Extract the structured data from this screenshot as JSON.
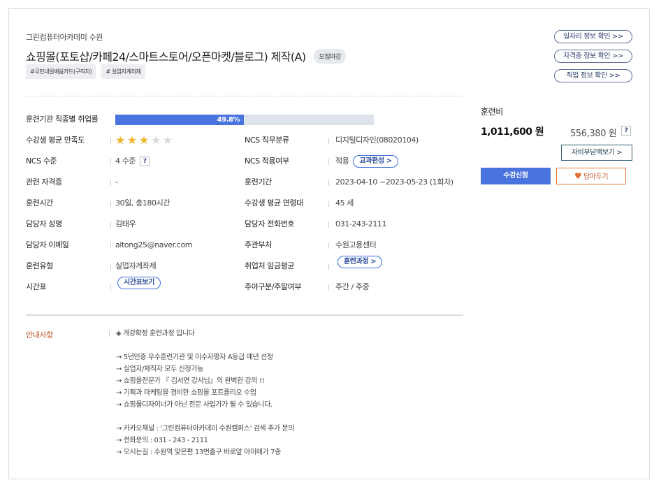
{
  "header": {
    "academy": "그린컴퓨터아카데미 수원",
    "title": "쇼핑몰(포토샵/카페24/스마트스토어/오픈마켓/블로그) 제작(A)",
    "status_badge": "모집마감",
    "tags": [
      "#국민내일배움카드(구직자)",
      "# 실업자계좌제"
    ]
  },
  "info_buttons": [
    "일자리 정보 확인 >>",
    "자격증 정보 확인 >>",
    "직업 정보 확인 >>"
  ],
  "details": {
    "employment_rate_label": "훈련기관 직종별 취업률",
    "employment_rate_text": "49.8%",
    "employment_rate_fraction": 0.498,
    "satisfaction_label": "수강생 평균 만족도",
    "satisfaction_stars": 3,
    "satisfaction_max": 5,
    "ncs_category_label": "NCS 직무분류",
    "ncs_category_value": "디지털디자인(08020104)",
    "ncs_level_label": "NCS 수준",
    "ncs_level_value": "4 수준",
    "ncs_apply_label": "NCS 적용여부",
    "ncs_apply_value": "적용",
    "curriculum_button": "교과편성 >",
    "cert_label": "관련 자격증",
    "cert_value": "-",
    "period_label": "훈련기간",
    "period_value": "2023-04-10 ~2023-05-23 (1회차)",
    "hours_label": "훈련시간",
    "hours_value": "30일, 총180시간",
    "age_label": "수강생 평균 연령대",
    "age_value": "45 세",
    "manager_label": "담당자 성명",
    "manager_value": "김태우",
    "phone_label": "담당자 전화번호",
    "phone_value": "031-243-2111",
    "email_label": "담당자 이메일",
    "email_value": "altong25@naver.com",
    "org_label": "주관부처",
    "org_value": "수원고용센터",
    "type_label": "훈련유형",
    "type_value": "실업자계좌제",
    "wage_label": "취업처 임금평균",
    "wage_button": "훈련과정 >",
    "timetable_label": "시간표",
    "timetable_button": "시간표보기",
    "daynight_label": "주야구분/주말여부",
    "daynight_value": "주간 / 주중",
    "help_mark": "?"
  },
  "notice": {
    "label": "안내사항",
    "lines": [
      "◈ 개강확정 훈련과정 입니다",
      "",
      "→ 5년인증 우수훈련기관 및 이수자평자 A등급 매년 선정",
      "→ 실업자/재직자 모두 신청가능",
      "→ 쇼핑몰전문가 『 김서연 강사님』의 완벽한 강의 !!",
      "→ 기획과 마케팅을 겸비한 쇼핑몰 포트폴리오 수업",
      "→ 쇼핑몰디자이너가 아닌 전문 사업가가 될 수 있습니다.",
      "",
      "→ 카카오채널 : '그린컴퓨터아카데미 수원캠퍼스' 검색 추가 문의",
      "→ 전화문의 : 031 - 243 - 2111",
      "→ 오시는길 : 수원역 맞은편 13번출구 바로앞 아이메가 7층"
    ]
  },
  "fee": {
    "label": "훈련비",
    "total": "1,011,600 원",
    "self_pay": "556,380 원",
    "help_mark": "?",
    "copay_button": "자비부담액보기 >",
    "enroll_button": "수강신청",
    "wishlist_button": "담아두기"
  },
  "colors": {
    "accent_blue": "#4a74dd",
    "notice_orange": "#c0562a",
    "star_gold": "#f0b429"
  }
}
